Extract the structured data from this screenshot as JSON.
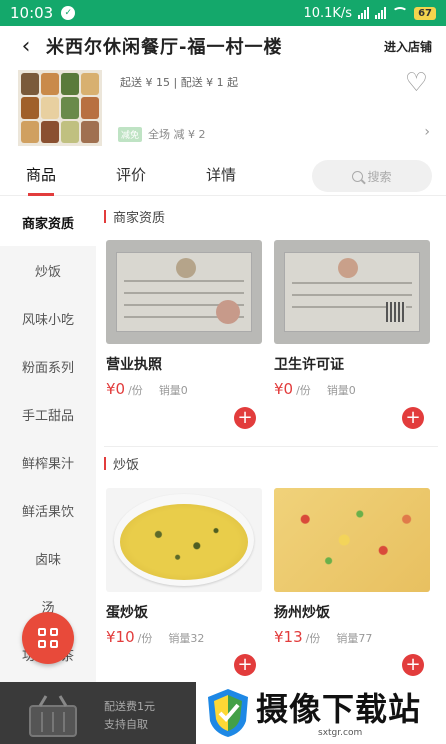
{
  "status_bar": {
    "time": "10:03",
    "shield_icon": "shield-icon",
    "network_speed": "10.1K/s",
    "battery": "67"
  },
  "header": {
    "back_icon": "arrow-left-icon",
    "store_name": "米西尔休闲餐厅-福一村一楼",
    "enter_store": "进入店铺"
  },
  "store_info": {
    "min_order": "起送 ¥ 15 | 配送 ¥ 1 起",
    "promo_tag": "减免",
    "promo_text": "全场 减 ¥ 2",
    "favorite_icon": "heart-icon"
  },
  "tabs": [
    {
      "label": "商品",
      "active": true
    },
    {
      "label": "评价",
      "active": false
    },
    {
      "label": "详情",
      "active": false
    }
  ],
  "search": {
    "label": "搜索"
  },
  "categories": [
    "商家资质",
    "炒饭",
    "风味小吃",
    "粉面系列",
    "手工甜品",
    "鲜榨果汁",
    "鲜活果饮",
    "卤味",
    "汤",
    "功夫奶茶"
  ],
  "sections": [
    {
      "title": "商家资质",
      "items": [
        {
          "name": "营业执照",
          "price": "¥0",
          "unit": "/份",
          "sales": "销量0"
        },
        {
          "name": "卫生许可证",
          "price": "¥0",
          "unit": "/份",
          "sales": "销量0"
        }
      ]
    },
    {
      "title": "炒饭",
      "items": [
        {
          "name": "蛋炒饭",
          "price": "¥10",
          "unit": "/份",
          "sales": "销量32"
        },
        {
          "name": "扬州炒饭",
          "price": "¥13",
          "unit": "/份",
          "sales": "销量77"
        }
      ]
    }
  ],
  "bottom_bar": {
    "cart_icon": "shopping-basket-icon",
    "delivery_fee": "配送费1元",
    "pickup": "支持自取"
  },
  "watermark": {
    "title": "摄像下载站",
    "url": "sxtgr.com"
  },
  "colors": {
    "status_bar": "#14a86b",
    "accent": "#e23c3c",
    "bottom_bar": "#3a3a3a"
  }
}
